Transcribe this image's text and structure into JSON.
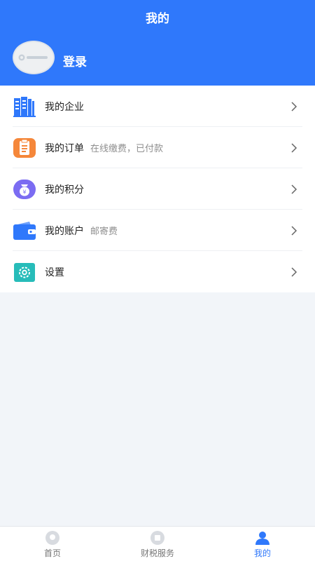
{
  "header": {
    "title": "我的",
    "login_label": "登录",
    "color": "#2f78fb"
  },
  "menu": {
    "items": [
      {
        "label": "我的企业",
        "sub": "",
        "icon": "building-icon",
        "color": "#2f78fb"
      },
      {
        "label": "我的订单",
        "sub": "在线缴费，已付款",
        "icon": "clipboard-icon",
        "color": "#f5873a"
      },
      {
        "label": "我的积分",
        "sub": "",
        "icon": "money-bag-icon",
        "color": "#7b6cf2"
      },
      {
        "label": "我的账户",
        "sub": "邮寄费",
        "icon": "wallet-icon",
        "color": "#2f78fb"
      },
      {
        "label": "设置",
        "sub": "",
        "icon": "gear-icon",
        "color": "#27bcb9"
      }
    ]
  },
  "tabbar": {
    "tabs": [
      {
        "label": "首页",
        "icon": "home-icon",
        "active": false
      },
      {
        "label": "财税服务",
        "icon": "service-icon",
        "active": false
      },
      {
        "label": "我的",
        "icon": "person-icon",
        "active": true
      }
    ]
  }
}
